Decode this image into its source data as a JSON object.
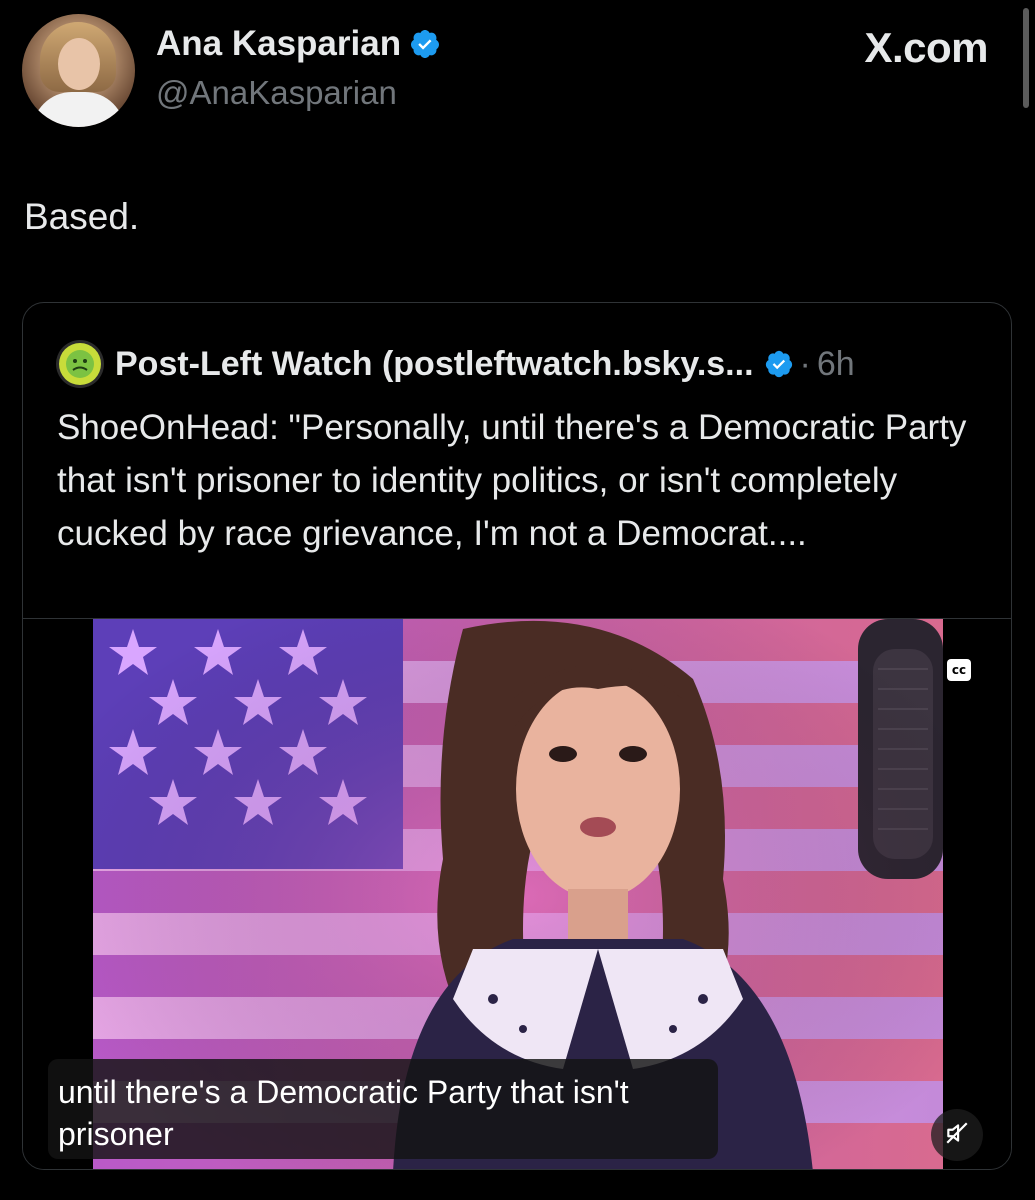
{
  "author": {
    "name": "Ana Kasparian",
    "handle": "@AnaKasparian",
    "verified": true
  },
  "site_label": "X.com",
  "tweet": {
    "text": "Based."
  },
  "quoted_post": {
    "author_name": "Post-Left Watch (postleftwatch.bsky.s...",
    "verified": true,
    "separator": "·",
    "time": "6h",
    "text": "ShoeOnHead: \"Personally, until there's a Democratic Party that isn't prisoner to identity politics, or isn't completely cucked by race grievance, I'm not a Democrat....",
    "video": {
      "cc_label": "cc",
      "caption": "until there's a Democratic Party that isn't prisoner",
      "muted": true
    }
  },
  "colors": {
    "background": "#000000",
    "text": "#e7e9ea",
    "secondary_text": "#71767b",
    "verified_blue": "#1d9bf0",
    "border": "#2f3336"
  }
}
